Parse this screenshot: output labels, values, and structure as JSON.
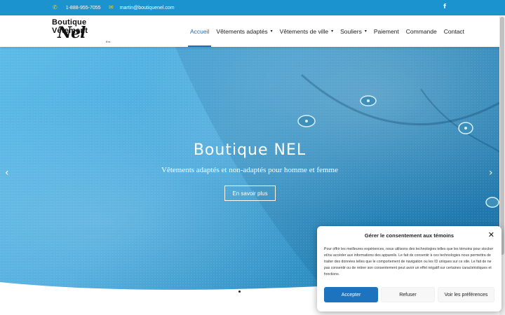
{
  "topbar": {
    "phone": "1-888-955-7055",
    "email": "martin@boutiquenel.com",
    "facebook_icon": "f",
    "colors": {
      "background": "#1a93cf",
      "icon": "#f2d21b"
    }
  },
  "logo": {
    "line1": "Boutique Vêtement",
    "line2": "Nel",
    "suffix": "Enr."
  },
  "nav": {
    "items": [
      {
        "label": "Accueil",
        "active": true
      },
      {
        "label": "Vêtements adaptés",
        "caret": "▾"
      },
      {
        "label": "Vêtements de ville",
        "caret": "▾"
      },
      {
        "label": "Souliers",
        "caret": "▾"
      },
      {
        "label": "Paiement"
      },
      {
        "label": "Commande"
      },
      {
        "label": "Contact"
      }
    ]
  },
  "hero": {
    "title": "Boutique NEL",
    "subtitle": "Vêtements adaptés et non-adaptés pour homme et femme",
    "button": "En savoir plus",
    "prev_icon": "‹",
    "next_icon": "›"
  },
  "consent": {
    "title": "Gérer le consentement aux témoins",
    "close_icon": "✕",
    "text": "Pour offrir les meilleures expériences, nous utilisons des technologies telles que les témoins pour stocker et/ou accéder aux informations des appareils. Le fait de consentir à ces technologies nous permettra de traiter des données telles que le comportement de navigation ou les ID uniques sur ce site. Le fait de ne pas consentir ou de retirer son consentement peut avoir un effet négatif sur certaines caractéristiques et fonctions.",
    "accept": "Accepter",
    "refuse": "Refuser",
    "preferences": "Voir les préférences"
  }
}
